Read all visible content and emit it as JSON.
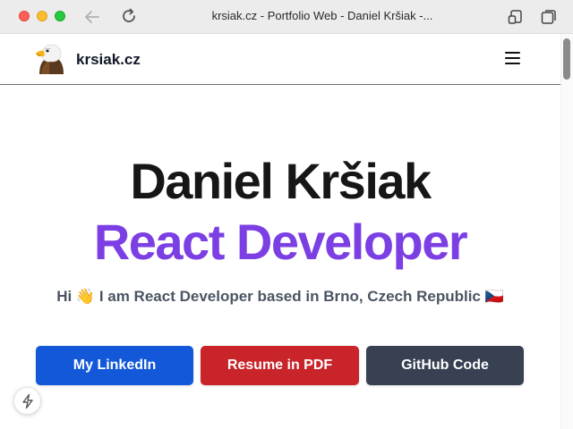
{
  "browser": {
    "tab_title": "krsiak.cz - Portfolio Web - Daniel Kršiak -...",
    "icons": [
      "back-arrow-icon",
      "reload-icon",
      "reader-mode-icon",
      "tabs-overview-icon"
    ]
  },
  "site": {
    "brand": "krsiak.cz",
    "logo_icon": "eagle-logo-icon",
    "menu_icon": "hamburger-menu-icon"
  },
  "hero": {
    "name": "Daniel Kršiak",
    "role": "React Developer",
    "subtitle": "Hi 👋 I am React Developer based in Brno, Czech Republic 🇨🇿"
  },
  "buttons": {
    "linkedin": "My LinkedIn",
    "resume": "Resume in PDF",
    "github": "GitHub Code"
  },
  "colors": {
    "role_accent": "#7b3fe4",
    "linkedin_button": "#1358d8",
    "resume_button": "#c8242a",
    "github_button": "#374151"
  },
  "floating_badge_icon": "lightning-bolt-icon"
}
